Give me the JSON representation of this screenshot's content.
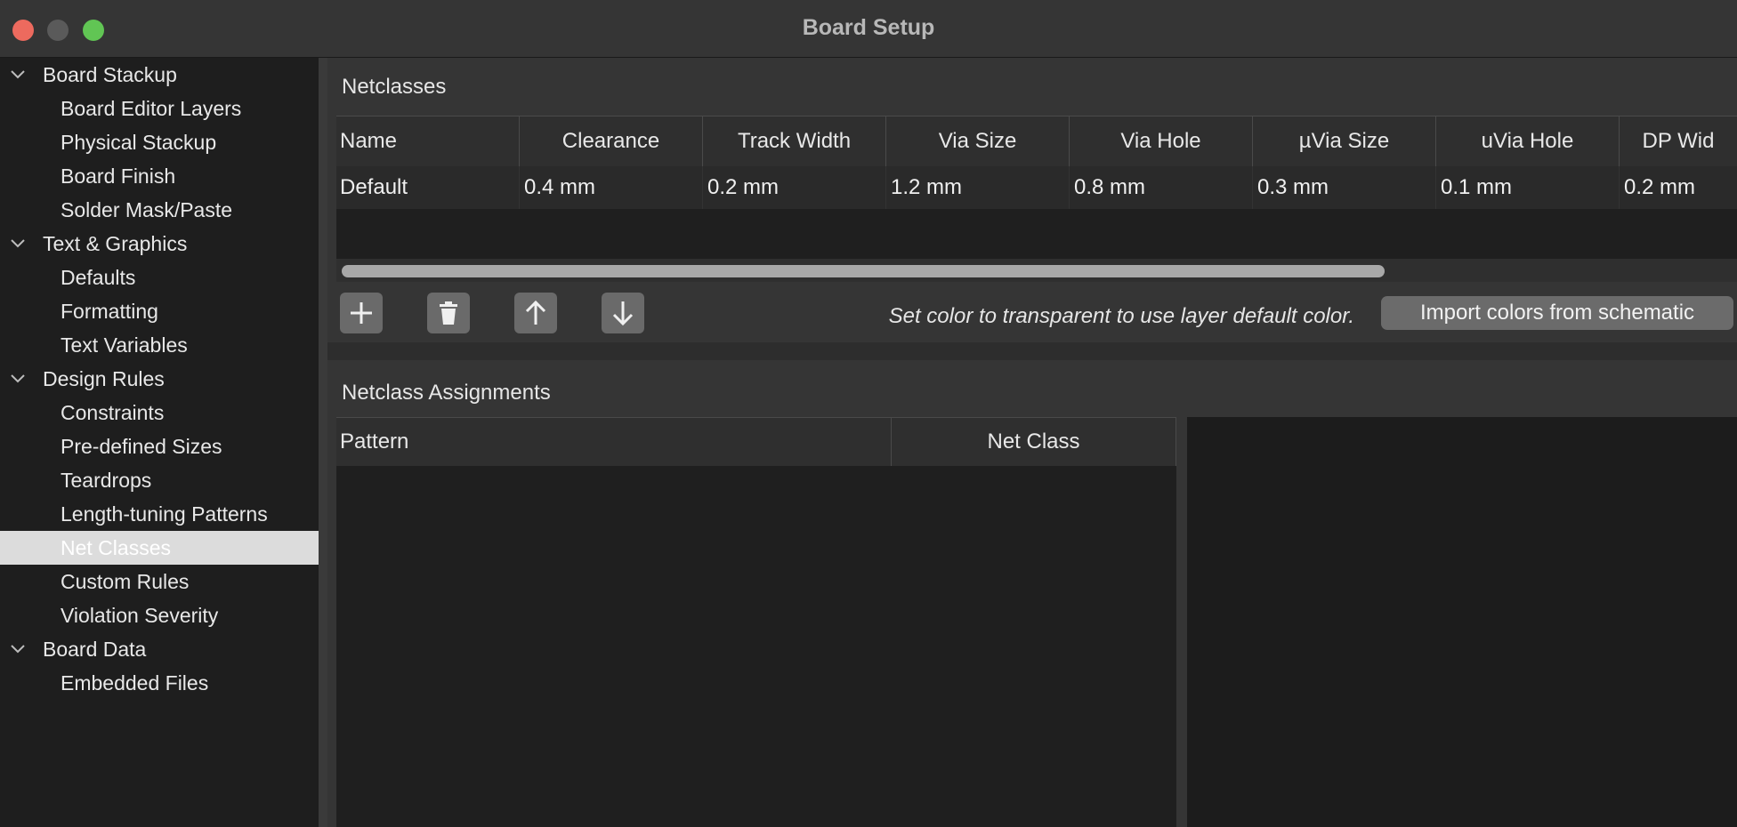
{
  "window": {
    "title": "Board Setup"
  },
  "sidebar": {
    "items": [
      {
        "label": "Board Stackup",
        "type": "group"
      },
      {
        "label": "Board Editor Layers",
        "type": "child"
      },
      {
        "label": "Physical Stackup",
        "type": "child"
      },
      {
        "label": "Board Finish",
        "type": "child"
      },
      {
        "label": "Solder Mask/Paste",
        "type": "child"
      },
      {
        "label": "Text & Graphics",
        "type": "group"
      },
      {
        "label": "Defaults",
        "type": "child"
      },
      {
        "label": "Formatting",
        "type": "child"
      },
      {
        "label": "Text Variables",
        "type": "child"
      },
      {
        "label": "Design Rules",
        "type": "group"
      },
      {
        "label": "Constraints",
        "type": "child"
      },
      {
        "label": "Pre-defined Sizes",
        "type": "child"
      },
      {
        "label": "Teardrops",
        "type": "child"
      },
      {
        "label": "Length-tuning Patterns",
        "type": "child"
      },
      {
        "label": "Net Classes",
        "type": "child",
        "selected": true
      },
      {
        "label": "Custom Rules",
        "type": "child"
      },
      {
        "label": "Violation Severity",
        "type": "child"
      },
      {
        "label": "Board Data",
        "type": "group"
      },
      {
        "label": "Embedded Files",
        "type": "child"
      }
    ]
  },
  "netclasses": {
    "title": "Netclasses",
    "columns": [
      "Name",
      "Clearance",
      "Track Width",
      "Via Size",
      "Via Hole",
      "µVia Size",
      "uVia Hole",
      "DP Wid"
    ],
    "rows": [
      [
        "Default",
        "0.4 mm",
        "0.2 mm",
        "1.2 mm",
        "0.8 mm",
        "0.3 mm",
        "0.1 mm",
        "0.2 mm"
      ]
    ],
    "hint": "Set color to transparent to use layer default color.",
    "import_button": "Import colors from schematic",
    "toolbar_icons": [
      "plus-icon",
      "trash-icon",
      "arrow-up-icon",
      "arrow-down-icon"
    ]
  },
  "assignments": {
    "title": "Netclass Assignments",
    "columns": [
      "Pattern",
      "Net Class"
    ]
  }
}
